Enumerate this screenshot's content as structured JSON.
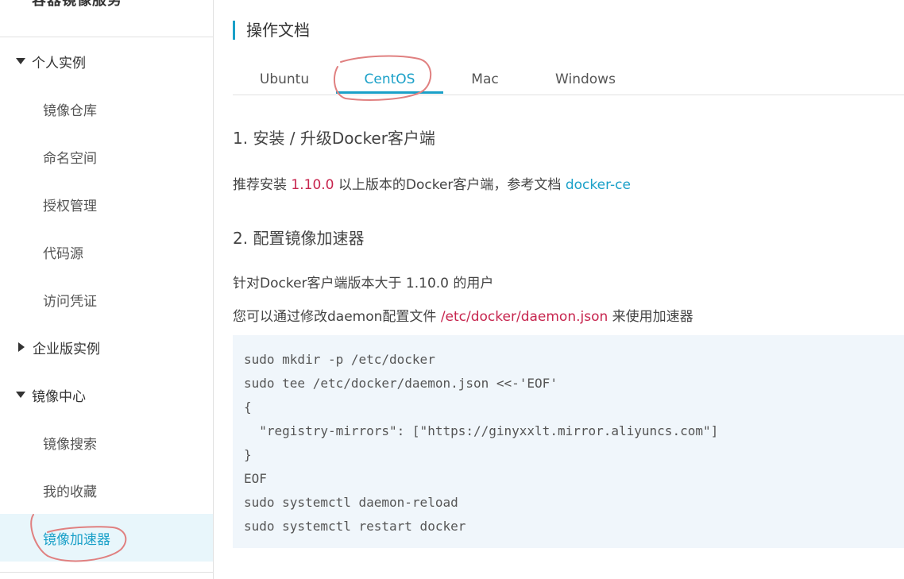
{
  "sidebar": {
    "title": "容器镜像服务",
    "groups": [
      {
        "label": "个人实例",
        "expanded": true,
        "items": [
          "镜像仓库",
          "命名空间",
          "授权管理",
          "代码源",
          "访问凭证"
        ]
      },
      {
        "label": "企业版实例",
        "expanded": false,
        "items": []
      },
      {
        "label": "镜像中心",
        "expanded": true,
        "items": [
          "镜像搜索",
          "我的收藏",
          "镜像加速器"
        ]
      }
    ],
    "active_item": "镜像加速器"
  },
  "main": {
    "title": "操作文档",
    "tabs": [
      "Ubuntu",
      "CentOS",
      "Mac",
      "Windows"
    ],
    "active_tab": "CentOS",
    "step1": {
      "heading": "1. 安装 / 升级Docker客户端",
      "text_before": "推荐安装 ",
      "version": "1.10.0",
      "text_middle": " 以上版本的Docker客户端，参考文档 ",
      "link": "docker-ce"
    },
    "step2": {
      "heading": "2. 配置镜像加速器",
      "line1": "针对Docker客户端版本大于 1.10.0 的用户",
      "line2_before": "您可以通过修改daemon配置文件 ",
      "config_path": "/etc/docker/daemon.json",
      "line2_after": " 来使用加速器"
    },
    "code": [
      "sudo mkdir -p /etc/docker",
      "sudo tee /etc/docker/daemon.json <<-'EOF'",
      "{",
      "  \"registry-mirrors\": [\"https://ginyxxlt.mirror.aliyuncs.com\"]",
      "}",
      "EOF",
      "sudo systemctl daemon-reload",
      "sudo systemctl restart docker"
    ]
  },
  "colors": {
    "accent": "#1aa0c8",
    "highlight_red": "#c7254e",
    "code_background": "#f0f6fb",
    "active_background": "#e8f6fb",
    "annotation": "#e08080"
  }
}
